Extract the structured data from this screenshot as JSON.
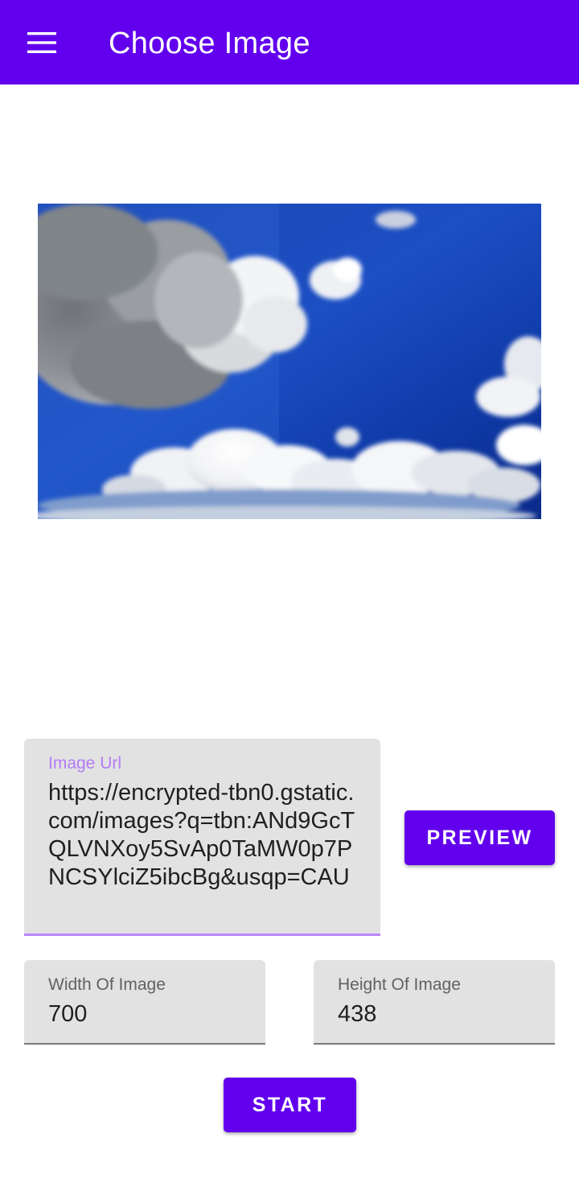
{
  "appbar": {
    "title": "Choose Image",
    "menu_icon": "menu-icon",
    "color": "#6200ee"
  },
  "preview": {
    "subject": "blue sky with white clouds"
  },
  "url_field": {
    "label": "Image Url",
    "value": "https://encrypted-tbn0.gstatic.com/images?q=tbn:ANd9GcTQLVNXoy5SvAp0TaMW0p7PNCSYlciZ5ibcBg&usqp=CAU",
    "accent": "#bb86fc"
  },
  "width_field": {
    "label": "Width Of Image",
    "value": "700"
  },
  "height_field": {
    "label": "Height Of Image",
    "value": "438"
  },
  "buttons": {
    "preview_label": "PREVIEW",
    "start_label": "START"
  }
}
